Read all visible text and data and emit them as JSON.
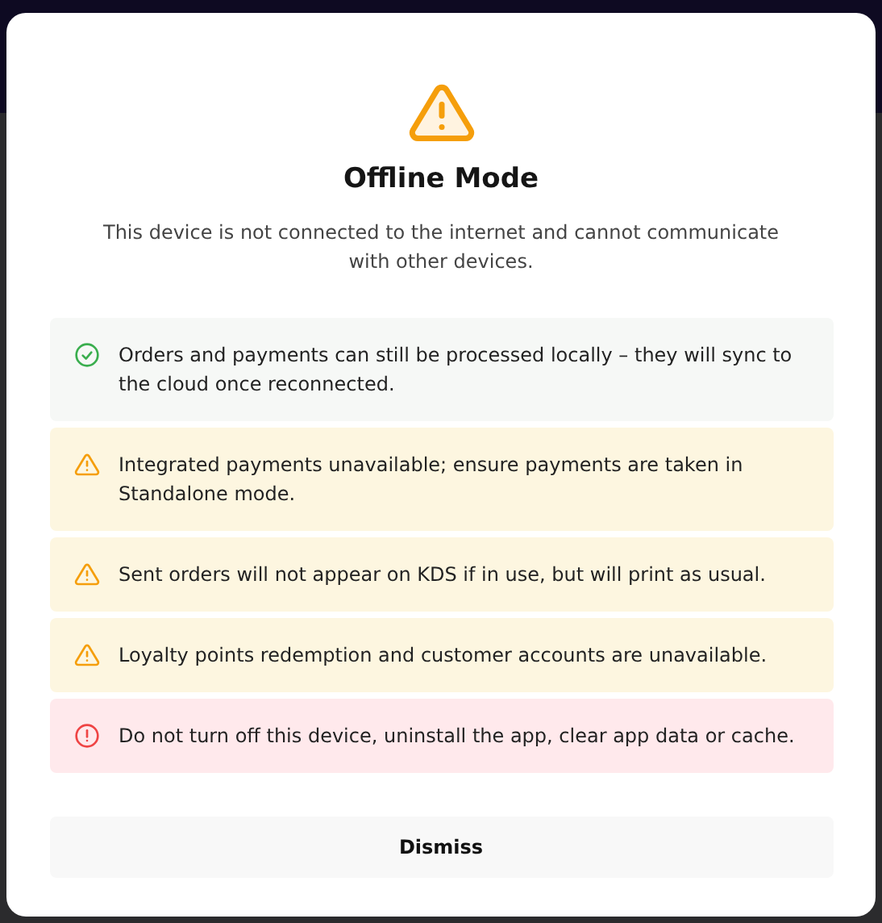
{
  "dialog": {
    "kind": "warning",
    "title": "Offline Mode",
    "message": "This device is not connected to the internet and cannot communicate with other devices.",
    "notices": [
      {
        "kind": "success",
        "text": "Orders and payments can still be processed locally – they will sync to the cloud once reconnected."
      },
      {
        "kind": "warning",
        "text": "Integrated payments unavailable; ensure payments are taken in Standalone mode."
      },
      {
        "kind": "warning",
        "text": "Sent orders will not appear on KDS if in use, but will print as usual."
      },
      {
        "kind": "warning",
        "text": "Loyalty points redemption and customer accounts are unavailable."
      },
      {
        "kind": "error",
        "text": "Do not turn off this device, uninstall the app, clear app data or cache."
      }
    ],
    "buttons": [
      "Dismiss"
    ]
  }
}
